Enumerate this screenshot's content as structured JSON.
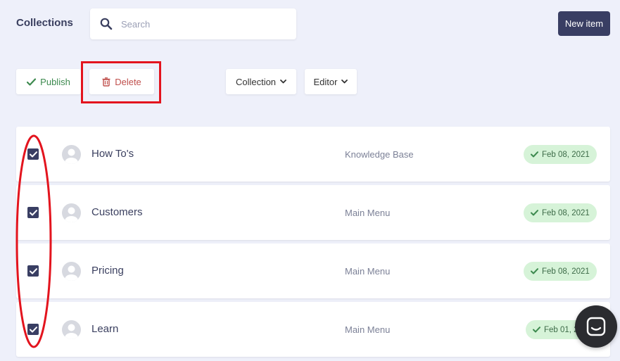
{
  "header": {
    "title": "Collections",
    "search_placeholder": "Search",
    "new_item_label": "New item"
  },
  "toolbar": {
    "publish_label": "Publish",
    "delete_label": "Delete",
    "collection_label": "Collection",
    "editor_label": "Editor"
  },
  "rows": [
    {
      "name": "How To's",
      "collection": "Knowledge Base",
      "date": "Feb 08, 2021",
      "checked": true
    },
    {
      "name": "Customers",
      "collection": "Main Menu",
      "date": "Feb 08, 2021",
      "checked": true
    },
    {
      "name": "Pricing",
      "collection": "Main Menu",
      "date": "Feb 08, 2021",
      "checked": true
    },
    {
      "name": "Learn",
      "collection": "Main Menu",
      "date": "Feb 01, 2021",
      "checked": true
    }
  ],
  "colors": {
    "accent": "#393e63",
    "annotation": "#e3141e",
    "badge_bg": "#d6f3d8"
  }
}
